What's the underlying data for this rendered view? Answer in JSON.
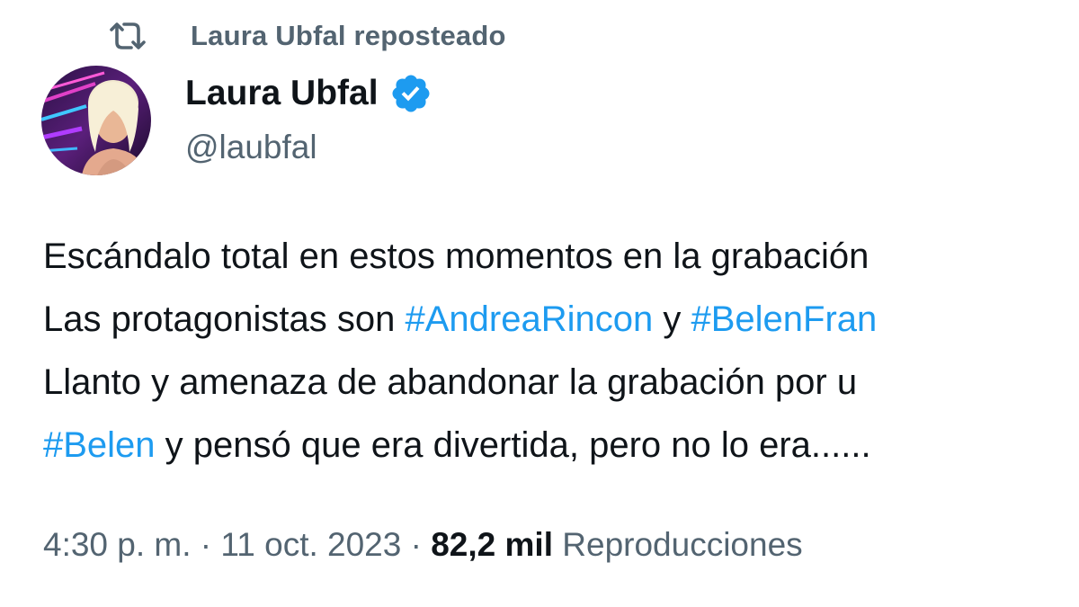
{
  "repost": {
    "icon": "repost-icon",
    "label": "Laura Ubfal reposteado"
  },
  "author": {
    "avatar": "avatar-photo",
    "display_name": "Laura Ubfal",
    "verified_icon": "verified-badge-icon",
    "handle": "@laubfal"
  },
  "tweet": {
    "lines": [
      {
        "segments": [
          {
            "text": "Escándalo total en estos momentos en la grabación",
            "hashtag": false
          }
        ]
      },
      {
        "segments": [
          {
            "text": "Las protagonistas son ",
            "hashtag": false
          },
          {
            "text": "#AndreaRincon",
            "hashtag": true
          },
          {
            "text": " y ",
            "hashtag": false
          },
          {
            "text": "#BelenFran",
            "hashtag": true
          }
        ]
      },
      {
        "segments": [
          {
            "text": "Llanto y amenaza de abandonar la grabación por u",
            "hashtag": false
          }
        ]
      },
      {
        "segments": [
          {
            "text": "#Belen",
            "hashtag": true
          },
          {
            "text": " y pensó que era divertida, pero no lo era......",
            "hashtag": false
          }
        ]
      }
    ]
  },
  "meta": {
    "time": "4:30 p. m.",
    "separator": " · ",
    "date": "11 oct. 2023",
    "views_count": "82,2 mil",
    "views_label": "Reproducciones"
  },
  "colors": {
    "text_primary": "#0f1419",
    "text_secondary": "#536471",
    "hashtag": "#1d9bf0",
    "verified": "#1d9bf0"
  }
}
